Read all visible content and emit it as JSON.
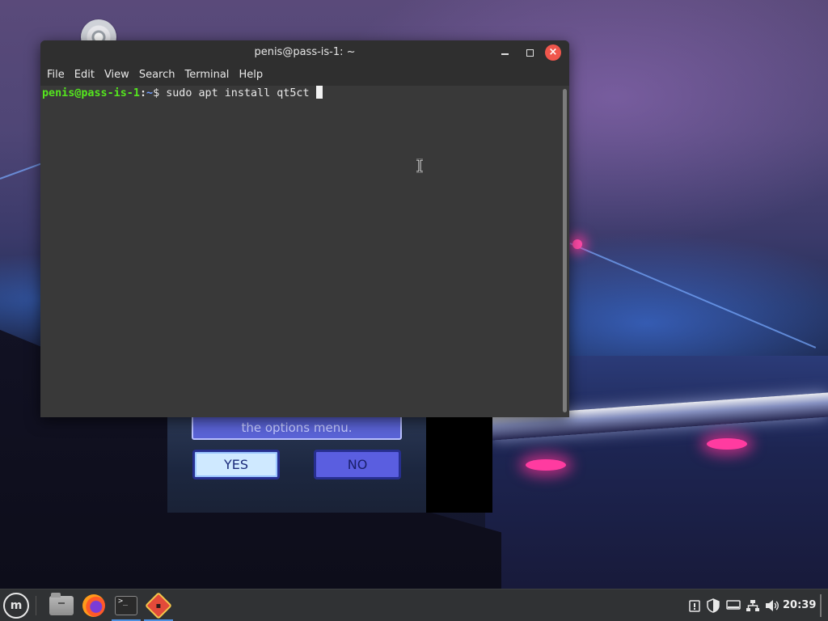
{
  "window": {
    "title": "penis@pass-is-1: ~",
    "close_glyph": "×"
  },
  "menubar": {
    "items": [
      "File",
      "Edit",
      "View",
      "Search",
      "Terminal",
      "Help"
    ]
  },
  "terminal": {
    "user_host": "penis@pass-is-1",
    "separator": ":",
    "path": "~",
    "prompt_symbol": "$",
    "command": "sudo apt install qt5ct"
  },
  "game_dialog": {
    "message": "the options menu.",
    "yes_label": "YES",
    "no_label": "NO"
  },
  "taskbar": {
    "menu_glyph": "m",
    "terminal_glyph": ">_",
    "clock": "20:39",
    "apps": [
      "files-icon",
      "firefox-icon",
      "terminal-icon",
      "game-icon"
    ]
  },
  "colors": {
    "prompt_user": "#55e61e",
    "prompt_path": "#6f9cff",
    "close_button": "#f0564c",
    "terminal_bg": "#393939"
  }
}
